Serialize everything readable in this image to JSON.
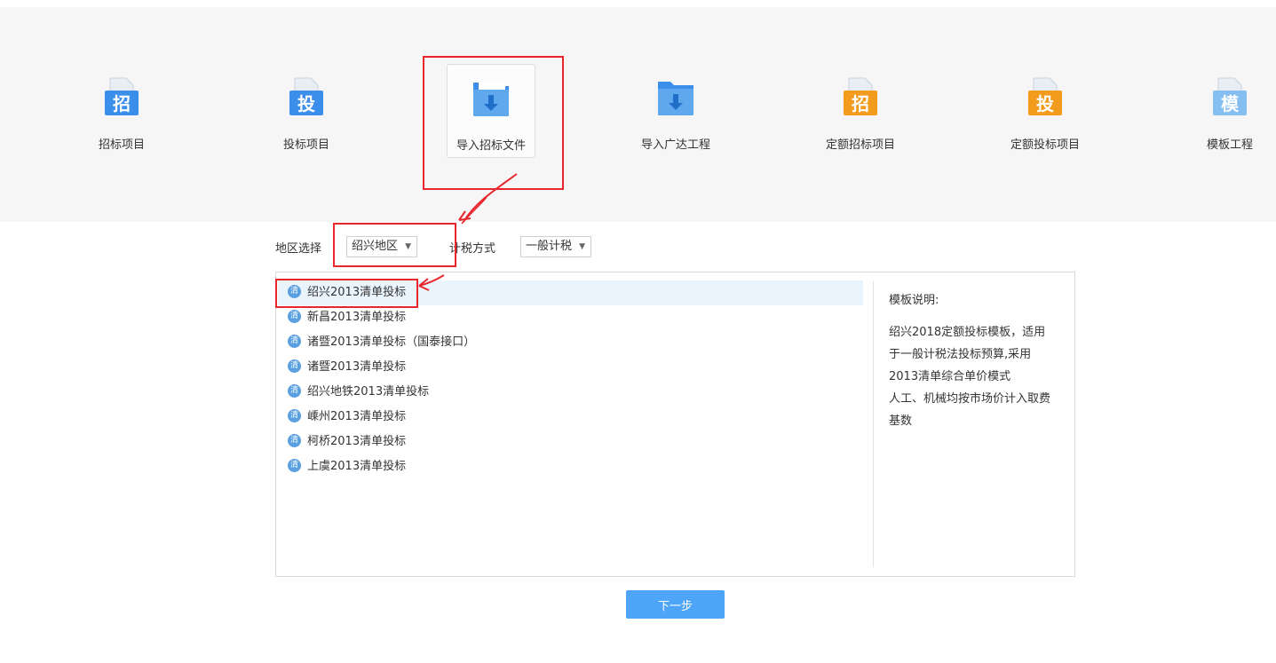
{
  "project_types": [
    {
      "label": "招标项目",
      "glyph": "招",
      "color": "#3b8eea"
    },
    {
      "label": "投标项目",
      "glyph": "投",
      "color": "#3b8eea"
    },
    {
      "label": "导入招标文件",
      "glyph": "",
      "color": "#5fa8ee"
    },
    {
      "label": "导入广达工程",
      "glyph": "",
      "color": "#5fa8ee"
    },
    {
      "label": "定额招标项目",
      "glyph": "招",
      "color": "#f39b1c"
    },
    {
      "label": "定额投标项目",
      "glyph": "投",
      "color": "#f39b1c"
    },
    {
      "label": "模板工程",
      "glyph": "模",
      "color": "#85bff1"
    }
  ],
  "selected_type_index": 2,
  "filters": {
    "region_label": "地区选择",
    "region_value": "绍兴地区",
    "tax_label": "计税方式",
    "tax_value": "一般计税"
  },
  "templates": [
    "绍兴2013清单投标",
    "新昌2013清单投标",
    "诸暨2013清单投标（国泰接口）",
    "诸暨2013清单投标",
    "绍兴地铁2013清单投标",
    "嵊州2013清单投标",
    "柯桥2013清单投标",
    "上虞2013清单投标"
  ],
  "template_icon_glyph": "清",
  "selected_template_index": 0,
  "description": {
    "title": "模板说明:",
    "lines": [
      "绍兴2018定额投标模板，适用",
      "于一般计税法投标预算,采用",
      "2013清单综合单价模式",
      "人工、机械均按市场价计入取费",
      "基数"
    ]
  },
  "next_button_label": "下一步",
  "colors": {
    "accent": "#4ea5f7",
    "annotation": "#e8262b",
    "selected_row": "#eaf4fd"
  }
}
